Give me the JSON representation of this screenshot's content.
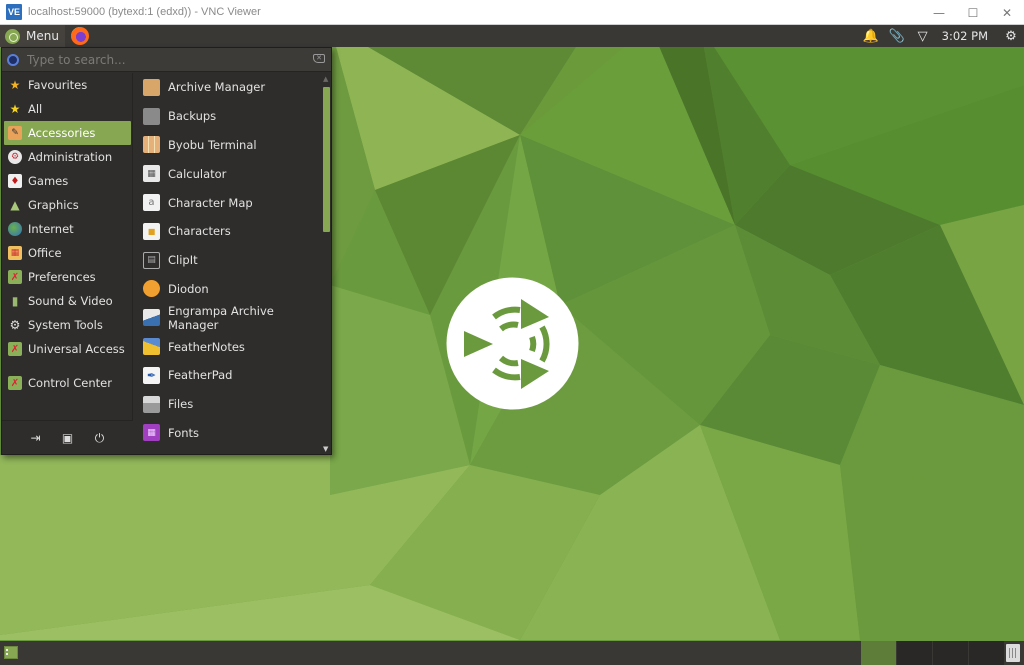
{
  "window": {
    "app_icon": "VE",
    "title": "localhost:59000 (bytexd:1 (edxd)) - VNC Viewer",
    "controls": [
      "minimize",
      "maximize",
      "close"
    ]
  },
  "top_panel": {
    "menu_label": "Menu",
    "launchers": [
      "firefox-icon"
    ],
    "tray": [
      "bell-icon",
      "paperclip-icon",
      "wifi-icon"
    ],
    "clock": "3:02 PM",
    "power": "power-gear-icon"
  },
  "menu": {
    "search_placeholder": "Type to search...",
    "search_value": "",
    "categories": [
      {
        "label": "Favourites",
        "icon": "star-icon"
      },
      {
        "label": "All",
        "icon": "star-icon"
      },
      {
        "label": "Accessories",
        "icon": "accessories-icon",
        "active": true
      },
      {
        "label": "Administration",
        "icon": "administration-icon"
      },
      {
        "label": "Games",
        "icon": "games-icon"
      },
      {
        "label": "Graphics",
        "icon": "graphics-icon"
      },
      {
        "label": "Internet",
        "icon": "globe-icon"
      },
      {
        "label": "Office",
        "icon": "office-icon"
      },
      {
        "label": "Preferences",
        "icon": "preferences-icon"
      },
      {
        "label": "Sound & Video",
        "icon": "sound-video-icon"
      },
      {
        "label": "System Tools",
        "icon": "gear-icon"
      },
      {
        "label": "Universal Access",
        "icon": "universal-access-icon"
      },
      {
        "label": "Control Center",
        "icon": "control-center-icon"
      }
    ],
    "apps": [
      {
        "label": "Archive Manager",
        "icon": "archive-icon"
      },
      {
        "label": "Backups",
        "icon": "backups-icon"
      },
      {
        "label": "Byobu Terminal",
        "icon": "byobu-icon"
      },
      {
        "label": "Calculator",
        "icon": "calculator-icon"
      },
      {
        "label": "Character Map",
        "icon": "character-map-icon"
      },
      {
        "label": "Characters",
        "icon": "characters-icon"
      },
      {
        "label": "ClipIt",
        "icon": "clipboard-icon"
      },
      {
        "label": "Diodon",
        "icon": "diodon-icon"
      },
      {
        "label": "Engrampa Archive Manager",
        "icon": "engrampa-icon"
      },
      {
        "label": "FeatherNotes",
        "icon": "feathernotes-icon"
      },
      {
        "label": "FeatherPad",
        "icon": "featherpad-icon"
      },
      {
        "label": "Files",
        "icon": "files-icon"
      },
      {
        "label": "Fonts",
        "icon": "fonts-icon"
      }
    ],
    "actions": [
      "logout-icon",
      "lock-screen-icon",
      "power-icon"
    ]
  },
  "colors": {
    "accent": "#87a752",
    "panel": "#3a3835",
    "menu_bg": "#2f2d2b"
  }
}
